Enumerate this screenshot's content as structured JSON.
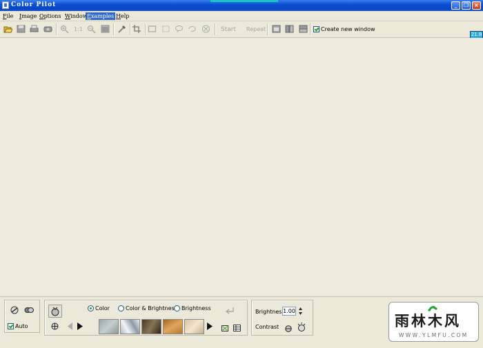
{
  "window": {
    "title": "Color Pilot",
    "buttons": [
      "_",
      "❐",
      "×"
    ]
  },
  "menu": {
    "items": [
      {
        "first": "F",
        "rest": "ile"
      },
      {
        "first": "I",
        "rest": "mage"
      },
      {
        "first": "O",
        "rest": "ptions"
      },
      {
        "first": "W",
        "rest": "indow"
      },
      {
        "first": "E",
        "rest": "xamples"
      },
      {
        "first": "H",
        "rest": "elp"
      }
    ],
    "active_index": 4
  },
  "toolbar": {
    "ratio_label": "1:1",
    "start_label": "Start",
    "repeat_label": "Repeat",
    "create_new_window_label": "Create new window",
    "create_new_window_checked": true,
    "zoom_readout": "21.8"
  },
  "panel": {
    "auto_label": "Auto",
    "auto_checked": true,
    "mode_options": [
      "Color",
      "Color & Brightness",
      "Brightness"
    ],
    "mode_selected": "Color",
    "brightness_label": "Brightness",
    "brightness_value": "1.00",
    "contrast_label": "Contrast"
  },
  "watermark": {
    "text_cn": "雨林木风",
    "url": "W W W . Y L M F U . C O M"
  },
  "colors": {
    "titlebar": "#0a4fd3",
    "accent": "#316ac5",
    "background": "#ece9d8"
  }
}
